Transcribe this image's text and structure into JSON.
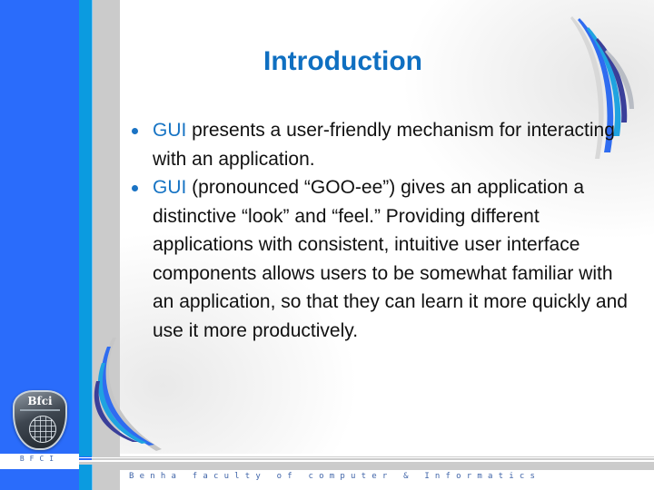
{
  "slide": {
    "title": "Introduction",
    "bullets": [
      {
        "accent": "GUI",
        "text": " presents a user-friendly mechanism for interacting with an application."
      },
      {
        "accent": "GUI",
        "text": " (pronounced “GOO-ee”) gives an application a distinctive “look” and “feel.” Providing different applications with consistent, intuitive user interface components allows users to be somewhat familiar with an application, so that they can learn it more quickly and use it more productively."
      }
    ]
  },
  "branding": {
    "logo_text": "Bfci",
    "sidebar_label": "BFCI",
    "footer_text": "Benha faculty of computer & Informatics"
  },
  "colors": {
    "title": "#0f6fc1",
    "accent": "#1774c4",
    "sidebar_blue": "#2a6cfb",
    "sidebar_cyan": "#0b9be0",
    "sidebar_gray": "#cbcbcb"
  },
  "icons": [
    "logo-emblem-icon",
    "globe-icon",
    "bullet-icon",
    "swoosh-decoration-icon"
  ]
}
